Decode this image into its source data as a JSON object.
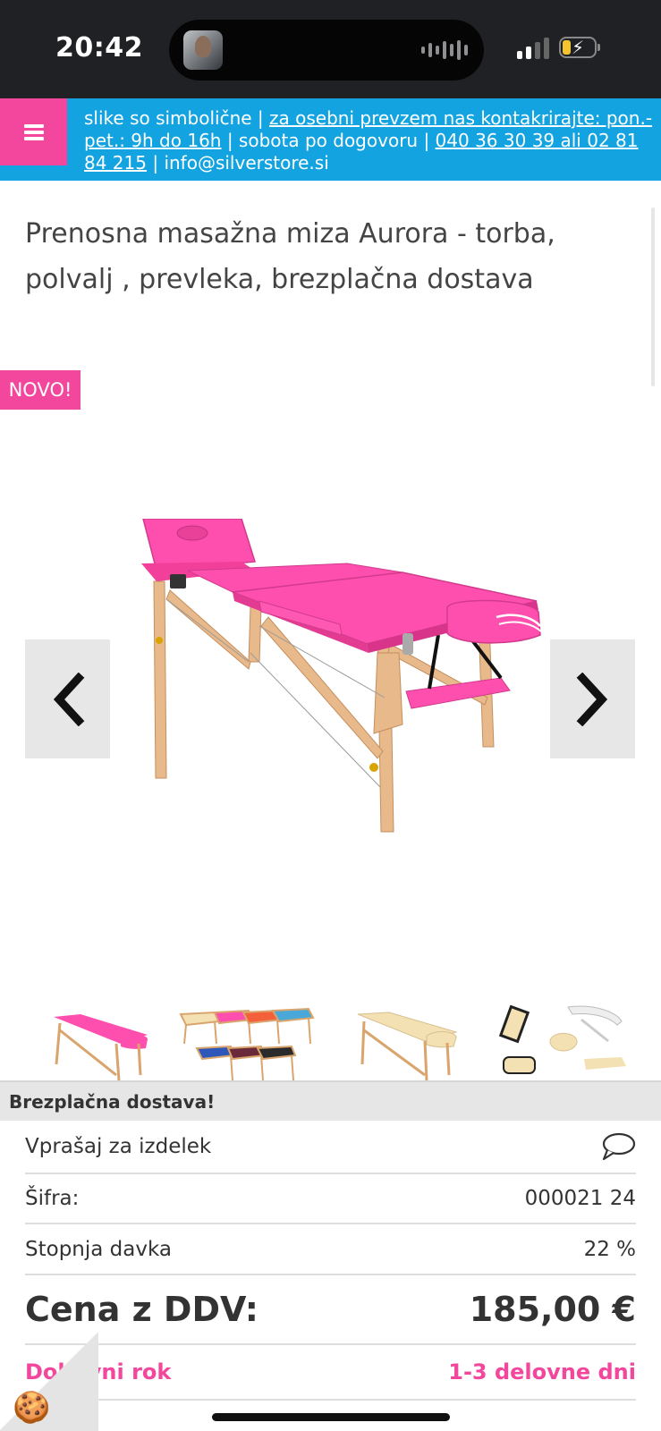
{
  "status_bar": {
    "time": "20:42"
  },
  "topbar": {
    "text_plain_1": "slike so simbolične | ",
    "link_pickup": "za osebni prevzem nas kontakrirajte: pon.-pet.: 9h do 16h",
    "text_plain_2": " | sobota po dogovoru | ",
    "link_phone": "040 36 30 39 ali 02 81 84 215",
    "text_plain_3": " | info@silverstore.si"
  },
  "product": {
    "title": "Prenosna masažna miza Aurora - torba, polvalj , prevleka, brezplačna dostava",
    "badge": "NOVO!",
    "table_color": "#ff4fae",
    "wood_color": "#e8b98a"
  },
  "info": {
    "free_delivery": "Brezplačna dostava!",
    "ask_label": "Vprašaj za izdelek",
    "sku_label": "Šifra:",
    "sku_value": "000021 24",
    "tax_label": "Stopnja davka",
    "tax_value": "22 %",
    "price_label": "Cena z DDV:",
    "price_value": "185,00 €",
    "delivery_label": "Dobavni rok",
    "delivery_value": "1-3 delovne dni"
  },
  "colors": {
    "accent_pink": "#f2479c",
    "accent_blue": "#13a3e0"
  }
}
